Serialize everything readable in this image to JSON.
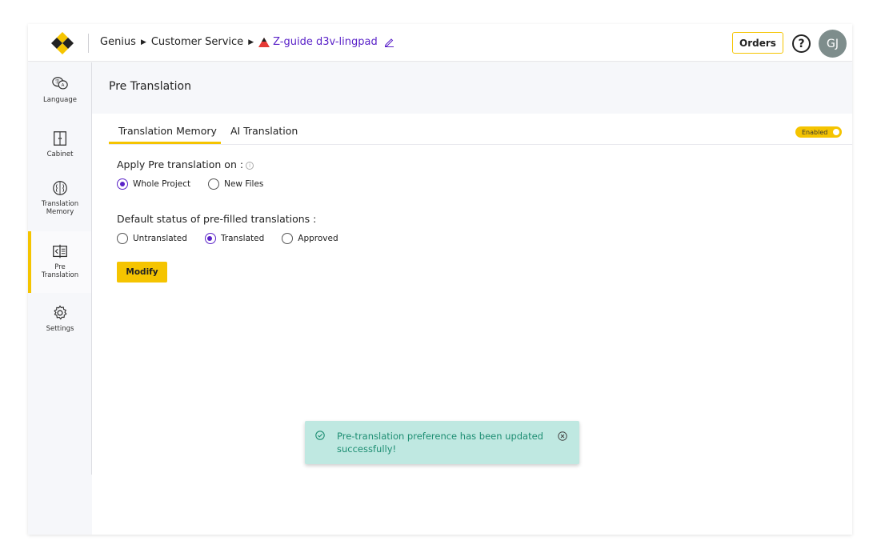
{
  "header": {
    "breadcrumb": [
      "Genius",
      "Customer Service"
    ],
    "project_name": "Z-guide d3v-lingpad",
    "orders_label": "Orders",
    "help_symbol": "?",
    "avatar_initials": "GJ"
  },
  "sidebar": {
    "items": [
      {
        "label": "Language",
        "icon": "language-icon"
      },
      {
        "label": "Cabinet",
        "icon": "cabinet-icon"
      },
      {
        "label": "Translation Memory",
        "icon": "brain-icon"
      },
      {
        "label": "Pre Translation",
        "icon": "pre-translation-icon",
        "active": true
      },
      {
        "label": "Settings",
        "icon": "gear-icon"
      }
    ]
  },
  "page": {
    "title": "Pre Translation",
    "tabs": [
      {
        "label": "Translation Memory",
        "active": true
      },
      {
        "label": "AI Translation",
        "active": false
      }
    ],
    "toggle_label": "Enabled",
    "apply_label": "Apply Pre translation on :",
    "apply_options": [
      {
        "label": "Whole Project",
        "selected": true
      },
      {
        "label": "New Files",
        "selected": false
      }
    ],
    "status_label": "Default status of pre-filled translations :",
    "status_options": [
      {
        "label": "Untranslated",
        "selected": false
      },
      {
        "label": "Translated",
        "selected": true
      },
      {
        "label": "Approved",
        "selected": false
      }
    ],
    "modify_label": "Modify"
  },
  "toast": {
    "message": "Pre-translation preference has been updated successfully!"
  },
  "colors": {
    "accent": "#f5c400",
    "primary": "#5a22c8",
    "toast_bg": "#bfe8e1",
    "toast_text": "#1e8e73"
  }
}
